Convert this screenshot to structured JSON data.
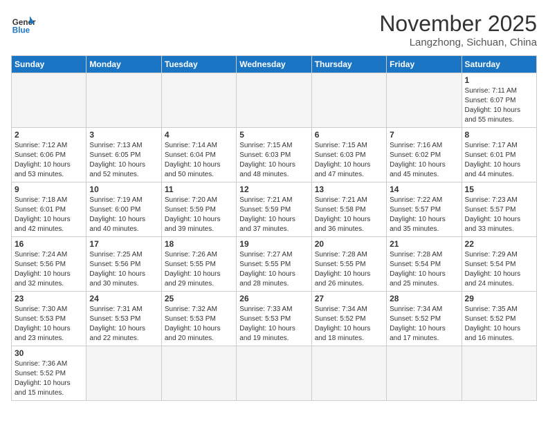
{
  "header": {
    "logo_general": "General",
    "logo_blue": "Blue",
    "month_title": "November 2025",
    "location": "Langzhong, Sichuan, China"
  },
  "days_of_week": [
    "Sunday",
    "Monday",
    "Tuesday",
    "Wednesday",
    "Thursday",
    "Friday",
    "Saturday"
  ],
  "weeks": [
    [
      {
        "day": "",
        "empty": true
      },
      {
        "day": "",
        "empty": true
      },
      {
        "day": "",
        "empty": true
      },
      {
        "day": "",
        "empty": true
      },
      {
        "day": "",
        "empty": true
      },
      {
        "day": "",
        "empty": true
      },
      {
        "day": "1",
        "sunrise": "7:11 AM",
        "sunset": "6:07 PM",
        "daylight": "10 hours and 55 minutes."
      }
    ],
    [
      {
        "day": "2",
        "sunrise": "7:12 AM",
        "sunset": "6:06 PM",
        "daylight": "10 hours and 53 minutes."
      },
      {
        "day": "3",
        "sunrise": "7:13 AM",
        "sunset": "6:05 PM",
        "daylight": "10 hours and 52 minutes."
      },
      {
        "day": "4",
        "sunrise": "7:14 AM",
        "sunset": "6:04 PM",
        "daylight": "10 hours and 50 minutes."
      },
      {
        "day": "5",
        "sunrise": "7:15 AM",
        "sunset": "6:03 PM",
        "daylight": "10 hours and 48 minutes."
      },
      {
        "day": "6",
        "sunrise": "7:15 AM",
        "sunset": "6:03 PM",
        "daylight": "10 hours and 47 minutes."
      },
      {
        "day": "7",
        "sunrise": "7:16 AM",
        "sunset": "6:02 PM",
        "daylight": "10 hours and 45 minutes."
      },
      {
        "day": "8",
        "sunrise": "7:17 AM",
        "sunset": "6:01 PM",
        "daylight": "10 hours and 44 minutes."
      }
    ],
    [
      {
        "day": "9",
        "sunrise": "7:18 AM",
        "sunset": "6:01 PM",
        "daylight": "10 hours and 42 minutes."
      },
      {
        "day": "10",
        "sunrise": "7:19 AM",
        "sunset": "6:00 PM",
        "daylight": "10 hours and 40 minutes."
      },
      {
        "day": "11",
        "sunrise": "7:20 AM",
        "sunset": "5:59 PM",
        "daylight": "10 hours and 39 minutes."
      },
      {
        "day": "12",
        "sunrise": "7:21 AM",
        "sunset": "5:59 PM",
        "daylight": "10 hours and 37 minutes."
      },
      {
        "day": "13",
        "sunrise": "7:21 AM",
        "sunset": "5:58 PM",
        "daylight": "10 hours and 36 minutes."
      },
      {
        "day": "14",
        "sunrise": "7:22 AM",
        "sunset": "5:57 PM",
        "daylight": "10 hours and 35 minutes."
      },
      {
        "day": "15",
        "sunrise": "7:23 AM",
        "sunset": "5:57 PM",
        "daylight": "10 hours and 33 minutes."
      }
    ],
    [
      {
        "day": "16",
        "sunrise": "7:24 AM",
        "sunset": "5:56 PM",
        "daylight": "10 hours and 32 minutes."
      },
      {
        "day": "17",
        "sunrise": "7:25 AM",
        "sunset": "5:56 PM",
        "daylight": "10 hours and 30 minutes."
      },
      {
        "day": "18",
        "sunrise": "7:26 AM",
        "sunset": "5:55 PM",
        "daylight": "10 hours and 29 minutes."
      },
      {
        "day": "19",
        "sunrise": "7:27 AM",
        "sunset": "5:55 PM",
        "daylight": "10 hours and 28 minutes."
      },
      {
        "day": "20",
        "sunrise": "7:28 AM",
        "sunset": "5:55 PM",
        "daylight": "10 hours and 26 minutes."
      },
      {
        "day": "21",
        "sunrise": "7:28 AM",
        "sunset": "5:54 PM",
        "daylight": "10 hours and 25 minutes."
      },
      {
        "day": "22",
        "sunrise": "7:29 AM",
        "sunset": "5:54 PM",
        "daylight": "10 hours and 24 minutes."
      }
    ],
    [
      {
        "day": "23",
        "sunrise": "7:30 AM",
        "sunset": "5:53 PM",
        "daylight": "10 hours and 23 minutes."
      },
      {
        "day": "24",
        "sunrise": "7:31 AM",
        "sunset": "5:53 PM",
        "daylight": "10 hours and 22 minutes."
      },
      {
        "day": "25",
        "sunrise": "7:32 AM",
        "sunset": "5:53 PM",
        "daylight": "10 hours and 20 minutes."
      },
      {
        "day": "26",
        "sunrise": "7:33 AM",
        "sunset": "5:53 PM",
        "daylight": "10 hours and 19 minutes."
      },
      {
        "day": "27",
        "sunrise": "7:34 AM",
        "sunset": "5:52 PM",
        "daylight": "10 hours and 18 minutes."
      },
      {
        "day": "28",
        "sunrise": "7:34 AM",
        "sunset": "5:52 PM",
        "daylight": "10 hours and 17 minutes."
      },
      {
        "day": "29",
        "sunrise": "7:35 AM",
        "sunset": "5:52 PM",
        "daylight": "10 hours and 16 minutes."
      }
    ],
    [
      {
        "day": "30",
        "sunrise": "7:36 AM",
        "sunset": "5:52 PM",
        "daylight": "10 hours and 15 minutes."
      },
      {
        "day": "",
        "empty": true
      },
      {
        "day": "",
        "empty": true
      },
      {
        "day": "",
        "empty": true
      },
      {
        "day": "",
        "empty": true
      },
      {
        "day": "",
        "empty": true
      },
      {
        "day": "",
        "empty": true
      }
    ]
  ]
}
